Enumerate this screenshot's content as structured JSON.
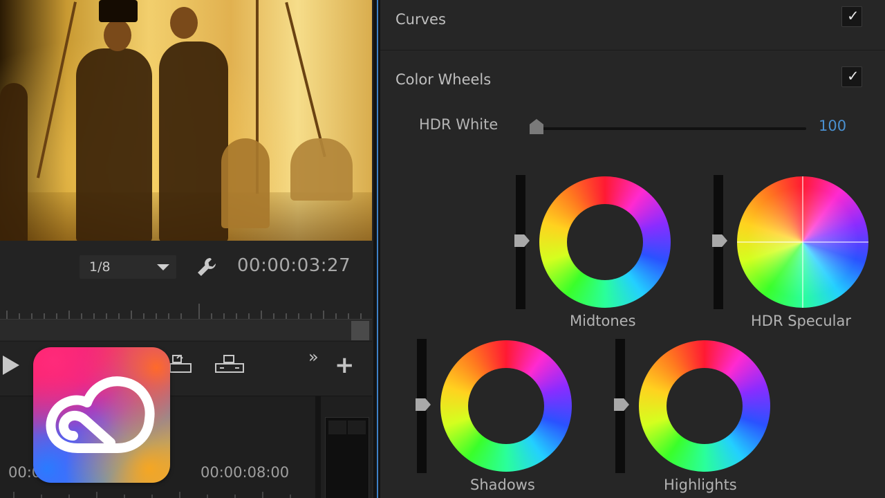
{
  "monitor": {
    "resolution_select": "1/8",
    "timecode": "00:00:03:27",
    "settings_icon": "wrench-icon"
  },
  "transport": {
    "icons": [
      "play-icon",
      "lift-icon",
      "extract-icon",
      "more-chevron-icon",
      "add-button-icon"
    ],
    "more_label": "»",
    "add_label": "+"
  },
  "timeline": {
    "timecode_left": "00:0",
    "timecode_right": "00:00:08:00"
  },
  "lumetri": {
    "curves": {
      "label": "Curves",
      "checked": true,
      "check_mark": "✓"
    },
    "color_wheels": {
      "label": "Color Wheels",
      "checked": true,
      "check_mark": "✓"
    },
    "hdr_white": {
      "label": "HDR White",
      "value": "100",
      "level": 0.0
    },
    "wheels": [
      {
        "label": "Midtones"
      },
      {
        "label": "HDR Specular"
      },
      {
        "label": "Shadows"
      },
      {
        "label": "Highlights"
      }
    ]
  },
  "colors": {
    "accent": "#4a90d0",
    "panel_bg": "#262626",
    "splitter_highlight": "#3d80c7"
  },
  "logo": {
    "name": "creative-cloud-logo"
  }
}
